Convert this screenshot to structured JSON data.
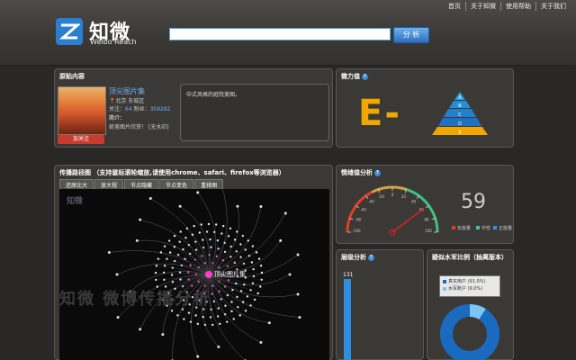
{
  "top_links": [
    "首页",
    "关于知微",
    "使用帮助",
    "关于我们"
  ],
  "brand": {
    "cn": "知微",
    "en": "Weibo Reach"
  },
  "search": {
    "value": "",
    "button": "分 析"
  },
  "profile_panel": {
    "title": "原贴内容",
    "name": "顶尖图片集",
    "location": "北京 东城区",
    "follow_label": "关注：",
    "follow_count": "64",
    "fans_label": "粉丝：",
    "fans_count": "359282",
    "intro_label": "简介：",
    "intro": "绝美图片欣赏！ [无水印]",
    "follow_button": "加关注",
    "quote": "中式风格的庭院美图。"
  },
  "influence_panel": {
    "title": "微力值",
    "grade": "E-",
    "pyramid_levels": [
      "A",
      "B",
      "C",
      "D",
      "E"
    ]
  },
  "graph_panel": {
    "title": "传播路径图 （支持鼠标滚轮缩放,请使用chrome、safari、firefox等浏览器）",
    "tabs": [
      "还原比大",
      "放大视",
      "节点隐藏",
      "节点变色",
      "重排图"
    ],
    "logo_text": "知微",
    "center_label": "顶尖图片集",
    "watermark": "知微 微博传播分析"
  },
  "emotion_panel": {
    "title": "情绪值分析",
    "score": "59",
    "gauge_ticks": [
      "-100",
      "-80",
      "-60",
      "-40",
      "-20",
      "0",
      "20",
      "40",
      "60",
      "80",
      "100"
    ],
    "legend": [
      {
        "label": "负能量",
        "color": "#e04020"
      },
      {
        "label": "中性",
        "color": "#40c0b0"
      },
      {
        "label": "正能量",
        "color": "#3a90e0"
      }
    ]
  },
  "level_panel": {
    "title": "层级分析",
    "count": "131"
  },
  "fans_panel": {
    "title": "疑似水军比例（抽离版本）",
    "legend": [
      {
        "label": "真实用户 (91.0%)",
        "color": "#1a6ac0"
      },
      {
        "label": "水军账户 (9.0%)",
        "color": "#7cc4f4"
      }
    ]
  }
}
